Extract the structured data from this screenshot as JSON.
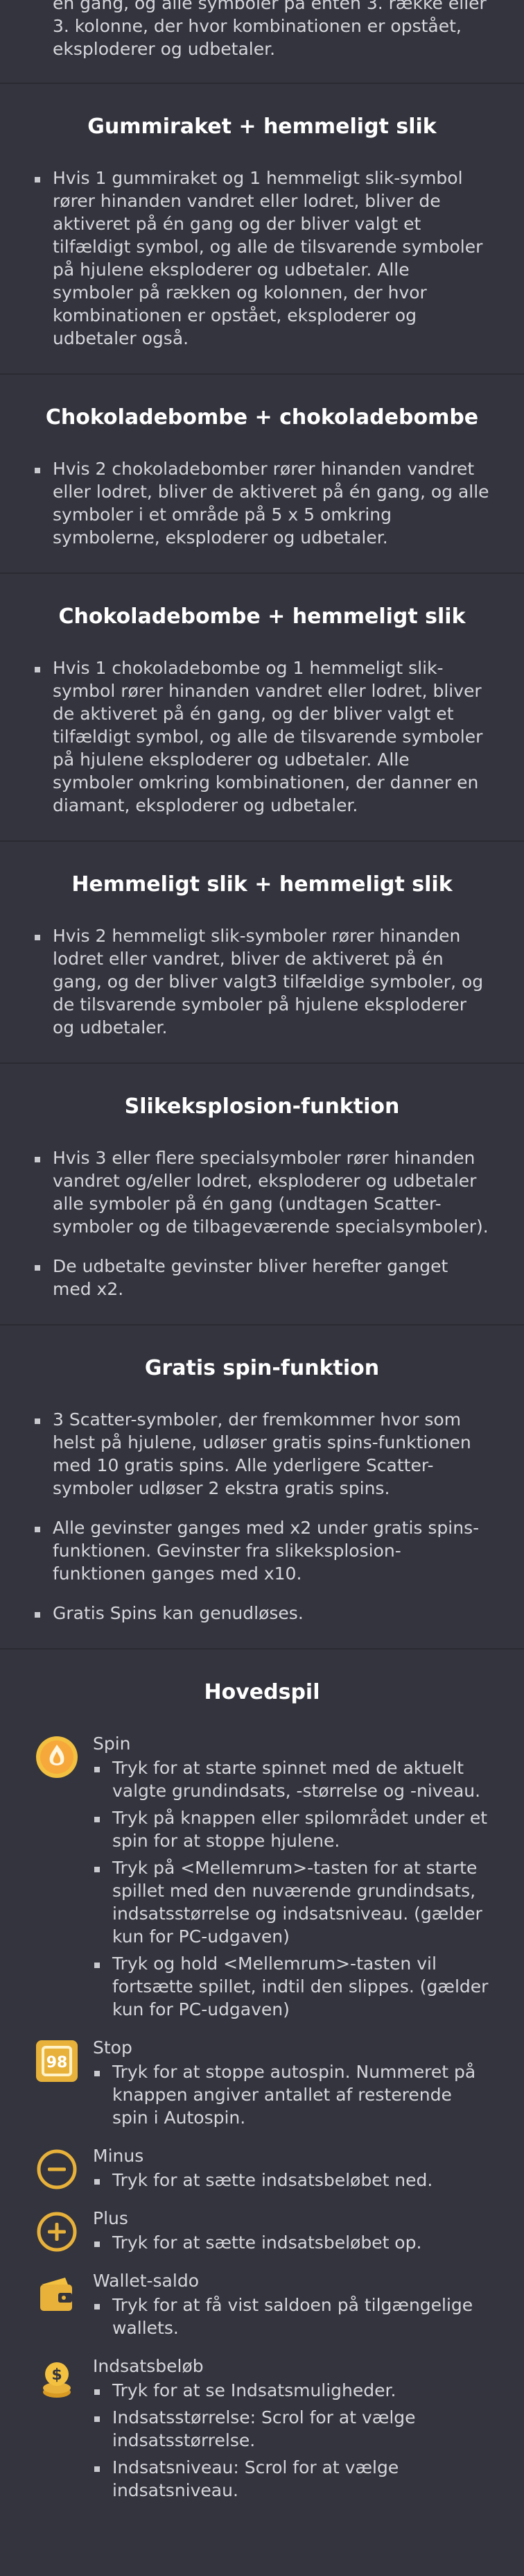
{
  "intro_text": "én gang, og alle symboler på enten 3. række eller 3. kolonne, der hvor kombinationen er opstået, eksploderer og udbetaler.",
  "sections": [
    {
      "title": "Gummiraket + hemmeligt slik",
      "items": [
        "Hvis 1 gummiraket og 1 hemmeligt slik-symbol rører hinanden vandret eller lodret, bliver de aktiveret på én gang og der bliver valgt et tilfældigt symbol, og alle de tilsvarende symboler på hjulene eksploderer og udbetaler. Alle symboler på rækken og kolonnen, der hvor kombinationen er opstået, eksploderer og udbetaler også."
      ]
    },
    {
      "title": "Chokoladebombe + chokoladebombe",
      "items": [
        "Hvis 2 chokoladebomber rører hinanden vandret eller lodret, bliver de aktiveret på én gang, og alle symboler i et område på 5 x 5 omkring symbolerne, eksploderer og udbetaler."
      ]
    },
    {
      "title": "Chokoladebombe + hemmeligt slik",
      "items": [
        "Hvis 1 chokoladebombe og 1 hemmeligt slik-symbol rører hinanden vandret eller lodret, bliver de aktiveret på én gang, og der bliver valgt et tilfældigt symbol, og alle de tilsvarende symboler på hjulene eksploderer og udbetaler. Alle symboler omkring kombinationen, der danner en diamant, eksploderer og udbetaler."
      ]
    },
    {
      "title": "Hemmeligt slik + hemmeligt slik",
      "items": [
        "Hvis 2 hemmeligt slik-symboler rører hinanden lodret eller vandret, bliver de aktiveret på én gang, og der bliver valgt3 tilfældige symboler, og de tilsvarende symboler på hjulene eksploderer og udbetaler."
      ]
    },
    {
      "title": "Slikeksplosion-funktion",
      "items": [
        "Hvis 3 eller flere specialsymboler rører hinanden vandret og/eller lodret, eksploderer og udbetaler alle symboler på én gang (undtagen Scatter-symboler og de tilbageværende specialsymboler).",
        "De udbetalte gevinster bliver herefter ganget med x2."
      ]
    },
    {
      "title": "Gratis spin-funktion",
      "items": [
        "3 Scatter-symboler, der fremkommer hvor som helst på hjulene, udløser gratis spins-funktionen med 10 gratis spins. Alle yderligere Scatter-symboler udløser 2 ekstra gratis spins.",
        "Alle gevinster ganges med x2 under gratis spins-funktionen. Gevinster fra slikeksplosion-funktionen ganges med x10.",
        "Gratis Spins kan genudløses."
      ]
    }
  ],
  "main": {
    "title": "Hovedspil",
    "features": [
      {
        "name": "Spin",
        "icon": "spin-icon",
        "items": [
          "Tryk for at starte spinnet med de aktuelt valgte grundindsats, -størrelse og -niveau.",
          "Tryk på knappen eller spilområdet under et spin for at stoppe hjulene.",
          "Tryk på <Mellemrum>-tasten for at starte spillet med den nuværende grundindsats, indsatsstørrelse og indsatsniveau. (gælder kun for PC-udgaven)",
          "Tryk og hold <Mellemrum>-tasten vil fortsætte spillet, indtil den slippes. (gælder kun for PC-udgaven)"
        ]
      },
      {
        "name": "Stop",
        "icon": "autospin-stop-icon",
        "badge": "98",
        "items": [
          "Tryk for at stoppe autospin. Nummeret på knappen angiver antallet af resterende spin i Autospin."
        ]
      },
      {
        "name": "Minus",
        "icon": "minus-icon",
        "items": [
          "Tryk for at sætte indsatsbeløbet ned."
        ]
      },
      {
        "name": "Plus",
        "icon": "plus-icon",
        "items": [
          "Tryk for at sætte indsatsbeløbet op."
        ]
      },
      {
        "name": "Wallet-saldo",
        "icon": "wallet-icon",
        "items": [
          "Tryk for at få vist saldoen på tilgængelige wallets."
        ]
      },
      {
        "name": "Indsatsbeløb",
        "icon": "coins-icon",
        "items": [
          "Tryk for at se Indsatsmuligheder.",
          "Indsatsstørrelse: Scrol for at vælge indsatsstørrelse.",
          "Indsatsniveau: Scrol for at vælge indsatsniveau."
        ]
      }
    ]
  },
  "colors": {
    "background": "#34343e",
    "divider": "#2a2a32",
    "icon_gold": "#e8b23a"
  }
}
